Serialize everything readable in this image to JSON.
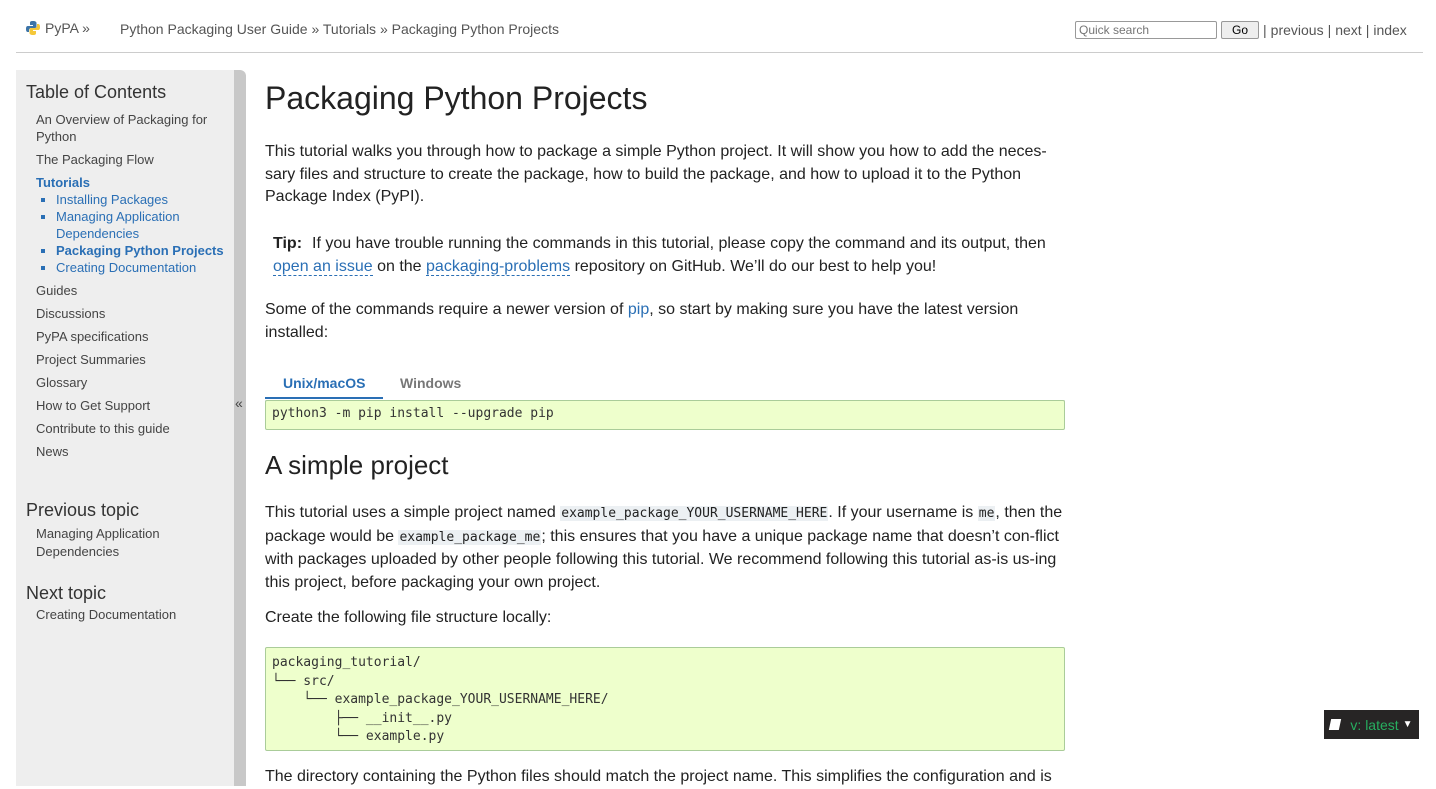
{
  "topbar": {
    "brand": "PyPA »",
    "crumbs": [
      "Python Packaging User Guide",
      "»",
      "Tutorials",
      "»",
      "Packaging Python Projects"
    ],
    "search_placeholder": "Quick search",
    "go_label": "Go",
    "nav": {
      "sep": "|",
      "previous": "previous",
      "next": "next",
      "index": "index"
    }
  },
  "sidebar": {
    "toc_title": "Table of Contents",
    "items": [
      "An Overview of Packaging for Python",
      "The Packaging Flow",
      "Tutorials",
      "Guides",
      "Discussions",
      "PyPA specifications",
      "Project Summaries",
      "Glossary",
      "How to Get Support",
      "Contribute to this guide",
      "News"
    ],
    "tutorials_sub": [
      "Installing Packages",
      "Managing Application Dependencies",
      "Packaging Python Projects",
      "Creating Documentation"
    ],
    "previous_title": "Previous topic",
    "previous_link": "Managing Application Dependencies",
    "next_title": "Next topic",
    "next_link": "Creating Documentation",
    "collapse": "«"
  },
  "main": {
    "title": "Packaging Python Projects",
    "intro": "This tutorial walks you through how to package a simple Python project. It will show you how to add the neces-sary files and structure to create the package, how to build the package, and how to upload it to the Python Package Index (PyPI).",
    "tip": {
      "label": "Tip:",
      "text1": "If you have trouble running the commands in this tutorial, please copy the command and its output, then",
      "link1": "open an issue",
      "text2": "on the",
      "link2": "packaging-problems",
      "text3": "repository on GitHub. We’ll do our best to help you!"
    },
    "pip_para": {
      "text1": "Some of the commands require a newer version of",
      "link": "pip",
      "text2": ", so start by making sure you have the latest version installed:"
    },
    "tabs": [
      "Unix/macOS",
      "Windows"
    ],
    "pip_command": "python3 -m pip install --upgrade pip",
    "section_title": "A simple project",
    "simple": {
      "t1": "This tutorial uses a simple project named",
      "c1": "example_package_YOUR_USERNAME_HERE",
      "t2": ". If your username is",
      "c2": "me",
      "t3": ", then the package would be",
      "c3": "example_package_me",
      "t4": "; this ensures that you have a unique package name that doesn’t con-flict with packages uploaded by other people following this tutorial. We recommend following this tutorial as-is us-ing this project, before packaging your own project."
    },
    "create_para": "Create the following file structure locally:",
    "tree": "packaging_tutorial/\n└── src/\n    └── example_package_YOUR_USERNAME_HERE/\n        ├── __init__.py\n        └── example.py",
    "bottom_para": "The directory containing the Python files should match the project name. This simplifies the configuration and is"
  },
  "badge": {
    "label": "v: latest"
  }
}
